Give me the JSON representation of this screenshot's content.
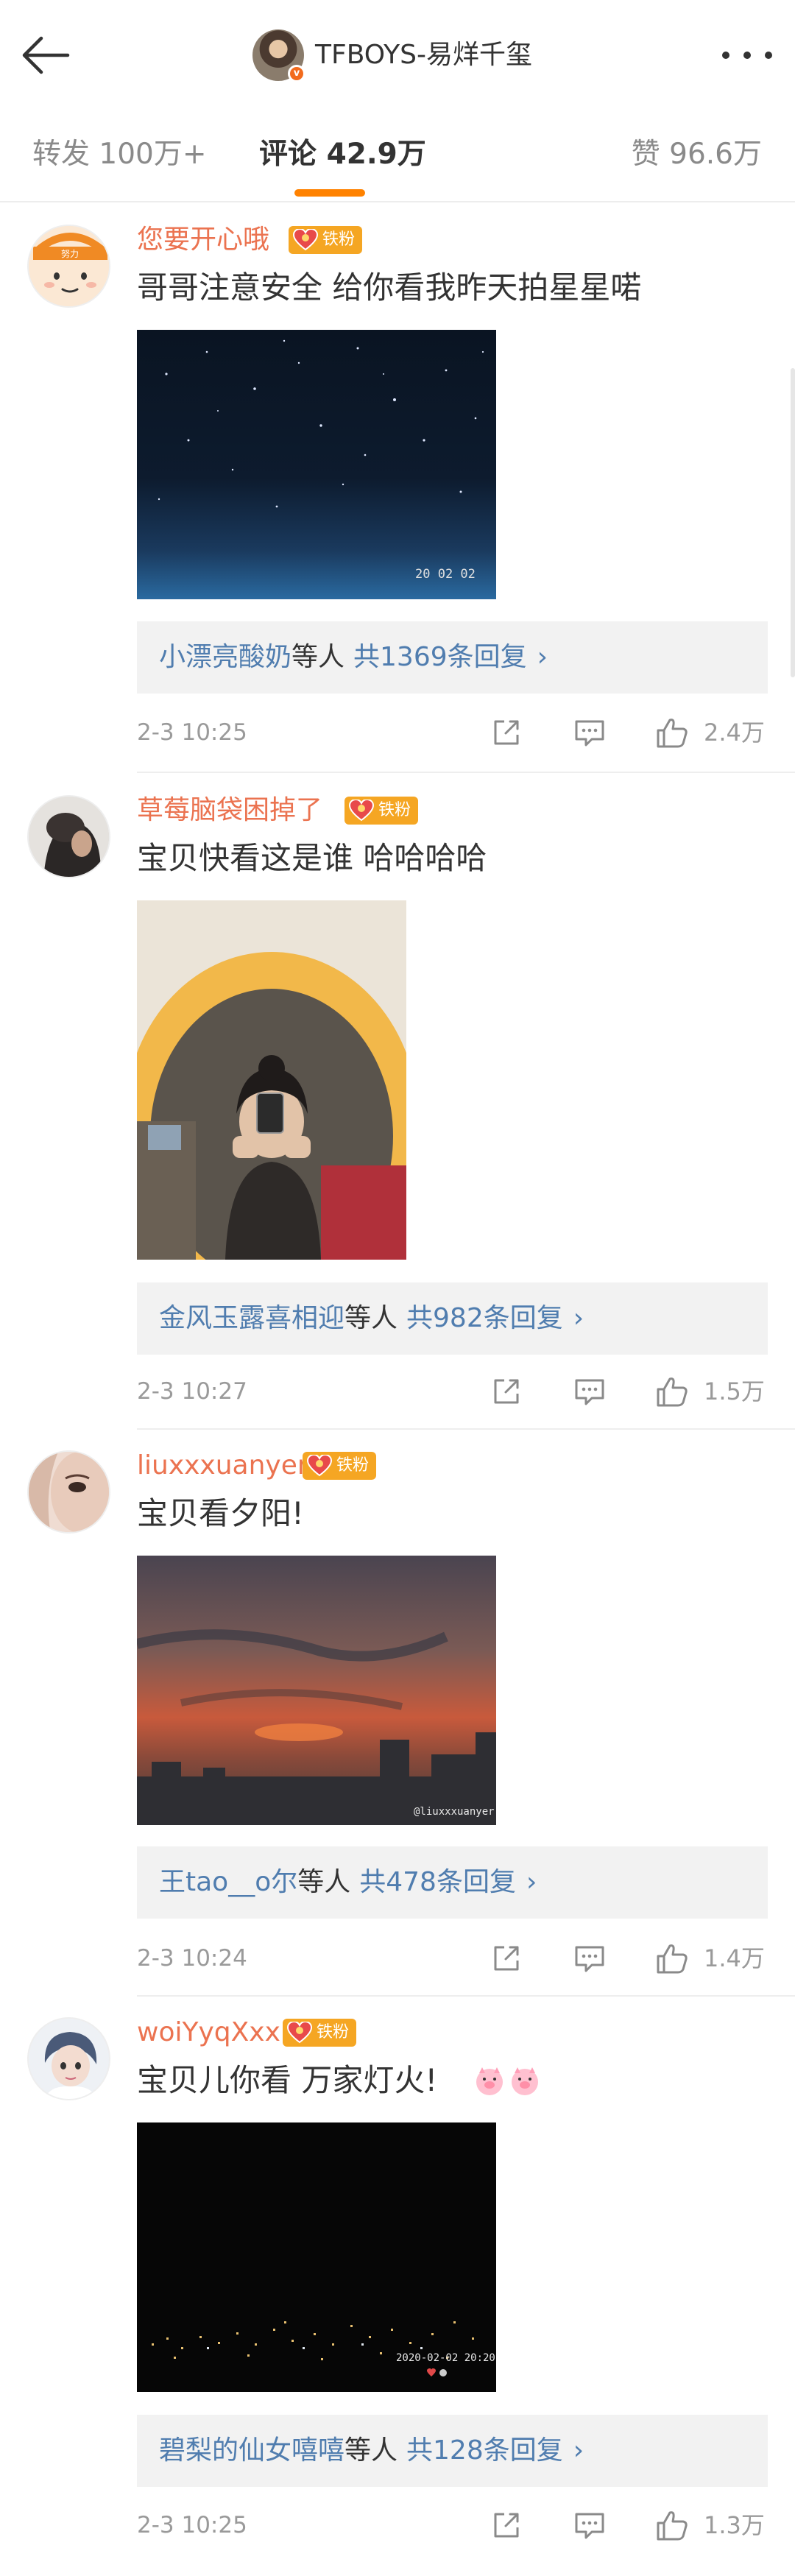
{
  "header": {
    "title": "TFBOYS-易烊千玺"
  },
  "tabs": {
    "repost": "转发 100万+",
    "comment": "评论 42.9万",
    "like": "赞 96.6万",
    "active_color": "#ff8200"
  },
  "badge_label": "铁粉",
  "comments": [
    {
      "username": "您要开心哦",
      "text": "哥哥注意安全 给你看我昨天拍星星喏",
      "photo_stamp": "20 02 02",
      "reply_names": "小漂亮酸奶",
      "reply_suffix": "等人",
      "reply_count": "共1369条回复",
      "reply_chevron": "›",
      "time": "2-3 10:25",
      "likes": "2.4万"
    },
    {
      "username": "草莓脑袋困掉了",
      "text": "宝贝快看这是谁  哈哈哈哈",
      "reply_names": "金风玉露喜相迎",
      "reply_suffix": "等人",
      "reply_count": "共982条回复",
      "reply_chevron": "›",
      "time": "2-3 10:27",
      "likes": "1.5万"
    },
    {
      "username": "liuxxxuanyer",
      "text": "宝贝看夕阳!",
      "photo_watermark": "@liuxxxuanyer",
      "reply_names": "王tao__o尔",
      "reply_suffix": "等人",
      "reply_count": "共478条回复",
      "reply_chevron": "›",
      "time": "2-3 10:24",
      "likes": "1.4万"
    },
    {
      "username": "woiYyqXxx",
      "text": "宝贝儿你看 万家灯火!",
      "photo_stamp": "2020-02-02 20:20",
      "reply_names": "碧梨的仙女嘻嘻",
      "reply_suffix": "等人",
      "reply_count": "共128条回复",
      "reply_chevron": "›",
      "time": "2-3 10:25",
      "likes": "1.3万"
    }
  ]
}
